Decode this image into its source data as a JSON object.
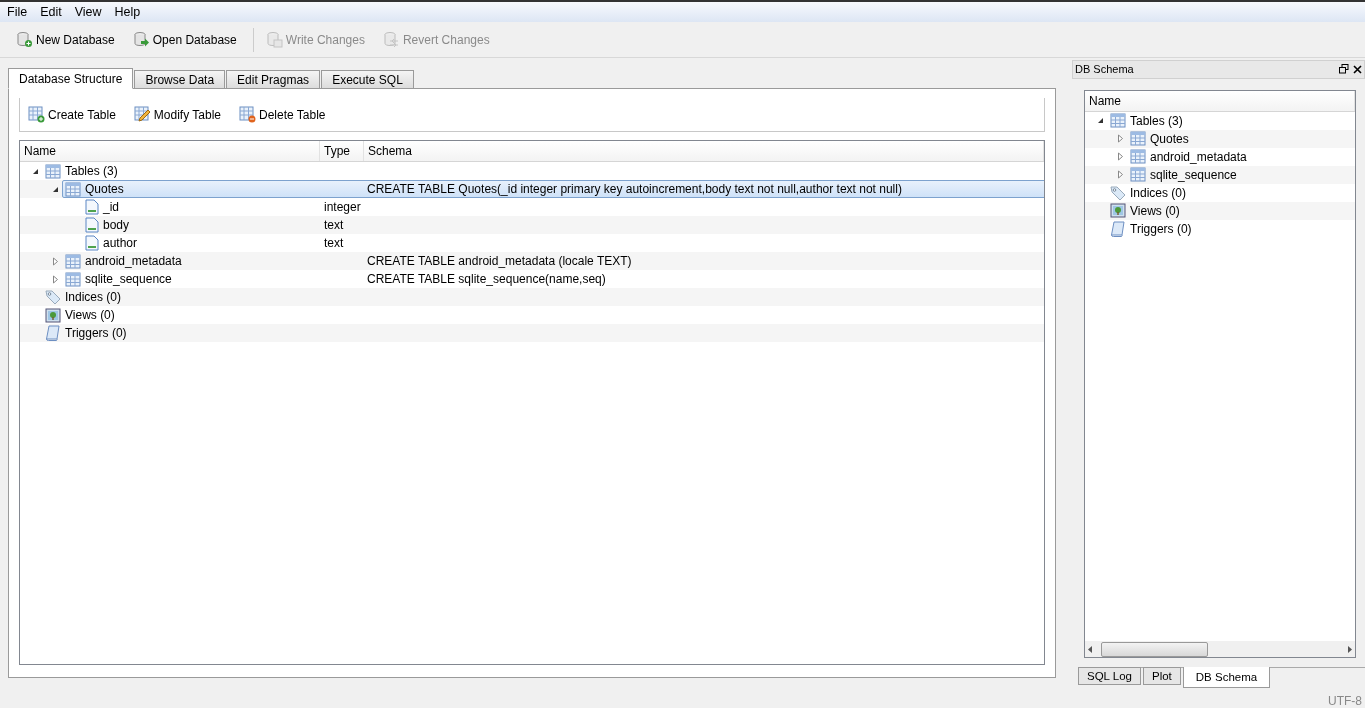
{
  "menu": [
    "File",
    "Edit",
    "View",
    "Help"
  ],
  "toolbar": [
    {
      "label": "New Database",
      "kind": "new",
      "disabled": false
    },
    {
      "label": "Open Database",
      "kind": "open",
      "disabled": false
    },
    {
      "label": "Write Changes",
      "kind": "write",
      "disabled": true
    },
    {
      "label": "Revert Changes",
      "kind": "revert",
      "disabled": true
    }
  ],
  "tabs": [
    {
      "label": "Database Structure",
      "selected": true
    },
    {
      "label": "Browse Data",
      "selected": false
    },
    {
      "label": "Edit Pragmas",
      "selected": false
    },
    {
      "label": "Execute SQL",
      "selected": false
    }
  ],
  "structure_toolbar": [
    {
      "label": "Create Table",
      "kind": "create"
    },
    {
      "label": "Modify Table",
      "kind": "modify"
    },
    {
      "label": "Delete Table",
      "kind": "delete"
    }
  ],
  "structure_tree": {
    "columns": [
      "Name",
      "Type",
      "Schema"
    ],
    "items": [
      {
        "name": "Tables (3)",
        "kind": "table",
        "expanded": true,
        "selected": false,
        "children": [
          {
            "name": "Quotes",
            "kind": "table",
            "expanded": true,
            "selected": true,
            "schema": "CREATE TABLE Quotes(_id integer primary key autoincrement,body text not null,author text not null)",
            "children": [
              {
                "name": "_id",
                "kind": "field",
                "selected": false,
                "type": "integer"
              },
              {
                "name": "body",
                "kind": "field",
                "selected": false,
                "type": "text"
              },
              {
                "name": "author",
                "kind": "field",
                "selected": false,
                "type": "text"
              }
            ]
          },
          {
            "name": "android_metadata",
            "kind": "table",
            "expanded": false,
            "selected": false,
            "schema": "CREATE TABLE android_metadata (locale TEXT)"
          },
          {
            "name": "sqlite_sequence",
            "kind": "table",
            "expanded": false,
            "selected": false,
            "schema": "CREATE TABLE sqlite_sequence(name,seq)"
          }
        ]
      },
      {
        "name": "Indices (0)",
        "kind": "index",
        "selected": false
      },
      {
        "name": "Views (0)",
        "kind": "view",
        "selected": false
      },
      {
        "name": "Triggers (0)",
        "kind": "trigger",
        "selected": false
      }
    ]
  },
  "dock": {
    "title": "DB Schema",
    "columns": [
      "Name"
    ],
    "items": [
      {
        "name": "Tables (3)",
        "kind": "table",
        "expanded": true,
        "children": [
          {
            "name": "Quotes",
            "kind": "table",
            "expanded": false
          },
          {
            "name": "android_metadata",
            "kind": "table",
            "expanded": false
          },
          {
            "name": "sqlite_sequence",
            "kind": "table",
            "expanded": false
          }
        ]
      },
      {
        "name": "Indices (0)",
        "kind": "index"
      },
      {
        "name": "Views (0)",
        "kind": "view"
      },
      {
        "name": "Triggers (0)",
        "kind": "trigger"
      }
    ]
  },
  "dock_tabs": [
    {
      "label": "SQL Log",
      "selected": false
    },
    {
      "label": "Plot",
      "selected": false
    },
    {
      "label": "DB Schema",
      "selected": true
    }
  ],
  "status_bar": "UTF-8"
}
